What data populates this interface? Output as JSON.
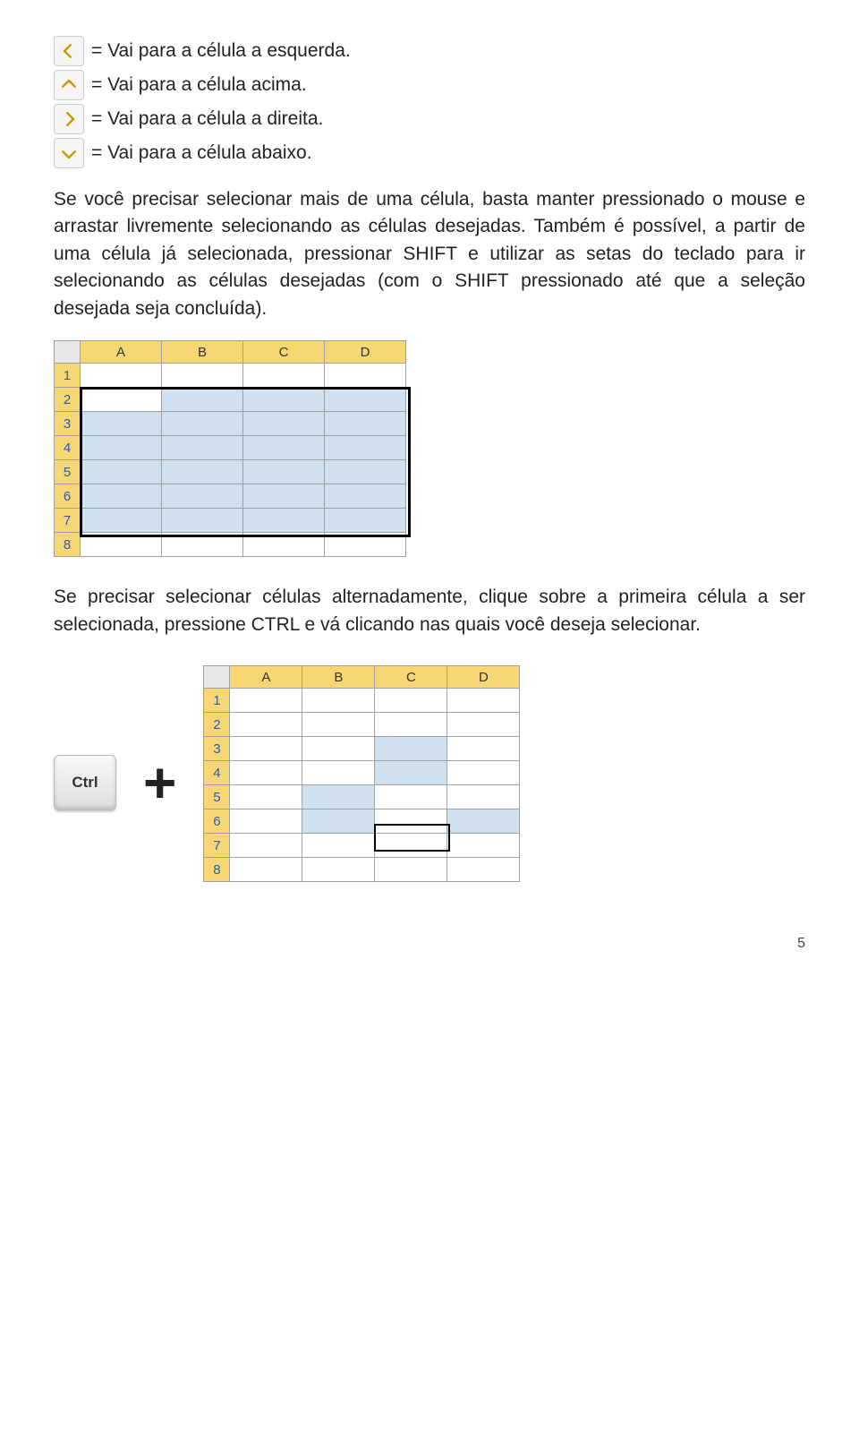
{
  "arrow_lines": [
    {
      "dir": "left",
      "text": "= Vai para a célula a esquerda."
    },
    {
      "dir": "up",
      "text": "= Vai para a célula acima."
    },
    {
      "dir": "right",
      "text": "= Vai para a célula a direita."
    },
    {
      "dir": "down",
      "text": "= Vai para a célula abaixo."
    }
  ],
  "para1": "Se você precisar selecionar mais de uma célula, basta manter pressionado o mouse e arrastar livremente selecionando as células desejadas. Também é possível, a partir de uma célula já selecionada, pressionar SHIFT e utilizar as setas do teclado para ir selecionando as células desejadas (com o SHIFT pressionado até que a seleção desejada seja concluída).",
  "para2": "Se precisar selecionar células alternadamente, clique sobre a primeira célula a ser selecionada, pressione CTRL e vá clicando nas quais você deseja selecionar.",
  "excel1": {
    "cols": [
      "A",
      "B",
      "C",
      "D"
    ],
    "rows": [
      "1",
      "2",
      "3",
      "4",
      "5",
      "6",
      "7",
      "8"
    ],
    "selection": {
      "r1": 2,
      "c1": 1,
      "r2": 7,
      "c2": 4
    },
    "active": {
      "r": 2,
      "c": 1
    }
  },
  "excel2": {
    "cols": [
      "A",
      "B",
      "C",
      "D"
    ],
    "rows": [
      "1",
      "2",
      "3",
      "4",
      "5",
      "6",
      "7",
      "8"
    ],
    "highlighted": [
      [
        3,
        3
      ],
      [
        4,
        3
      ],
      [
        5,
        2
      ],
      [
        6,
        2
      ],
      [
        6,
        4
      ]
    ],
    "active_border": {
      "r": 7,
      "c": 3
    }
  },
  "ctrl_label": "Ctrl",
  "plus_label": "+",
  "page_number": "5"
}
